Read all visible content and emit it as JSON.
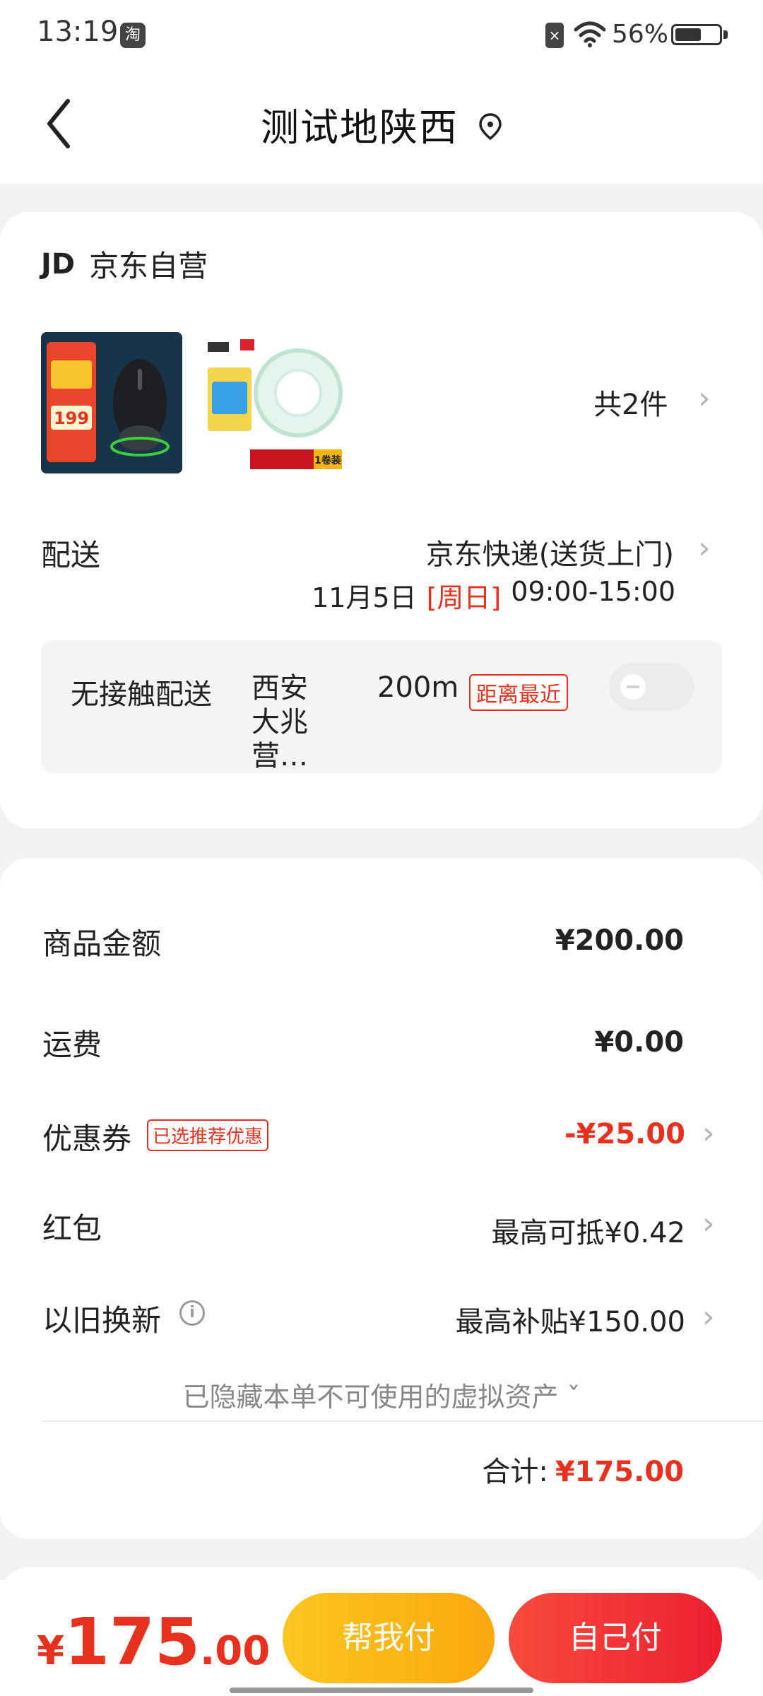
{
  "status_bar": {
    "time": "13:19",
    "battery": "56%",
    "app_badge": "淘"
  },
  "header": {
    "title": "测试地陕西"
  },
  "store": {
    "logo": "JD",
    "name": "京东自营",
    "item_count": "共2件",
    "products": [
      {
        "name": "mouse-product",
        "tag": "199"
      },
      {
        "name": "tape-product",
        "tag": "1卷装"
      }
    ]
  },
  "delivery": {
    "label": "配送",
    "method": "京东快递(送货上门)",
    "date": "11月5日",
    "weekday": "[周日]",
    "window": "09:00-15:00"
  },
  "contactless": {
    "label": "无接触配送",
    "pickup": "西安大兆营…",
    "distance": "200m",
    "badge": "距离最近"
  },
  "summary": {
    "goods_label": "商品金额",
    "goods_value": "¥200.00",
    "freight_label": "运费",
    "freight_value": "¥0.00",
    "coupon_label": "优惠券",
    "coupon_badge": "已选推荐优惠",
    "coupon_value": "-¥25.00",
    "redpacket_label": "红包",
    "redpacket_value": "最高可抵¥0.42",
    "tradein_label": "以旧换新",
    "tradein_value": "最高补贴¥150.00",
    "hidden_assets": "已隐藏本单不可使用的虚拟资产 ˇ",
    "total_label": "合计:",
    "total_value": "¥175.00"
  },
  "bottom_bar": {
    "currency": "¥",
    "price_int": "175",
    "price_dec": ".00",
    "help_pay": "帮我付",
    "self_pay": "自己付"
  },
  "colors": {
    "accent_red": "#e6311f",
    "help_yellow": "#fcc620",
    "pay_red": "#ec2030"
  }
}
